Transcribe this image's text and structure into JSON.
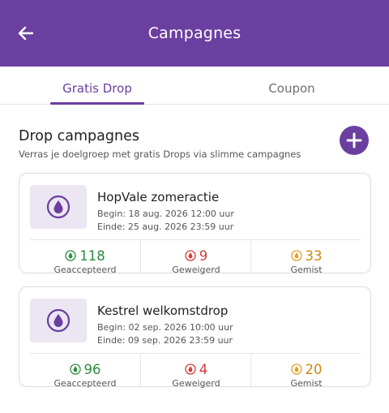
{
  "header": {
    "title": "Campagnes",
    "back_icon": "arrow-left-icon"
  },
  "tabs": [
    {
      "label": "Gratis Drop",
      "active": true
    },
    {
      "label": "Coupon",
      "active": false
    }
  ],
  "section": {
    "title": "Drop campagnes",
    "subtitle": "Verras je doelgroep met gratis Drops via slimme campagnes",
    "add_icon": "plus-icon"
  },
  "colors": {
    "brand": "#6b3fa0",
    "accepted": "#2e8b3e",
    "rejected": "#d23b3b",
    "missed": "#e3a020"
  },
  "campaigns": [
    {
      "name": "HopVale zomeractie",
      "begin": "Begin: 18 aug. 2026 12:00 uur",
      "end": "Einde: 25 aug. 2026 23:59 uur",
      "stats": {
        "accepted": {
          "value": "118",
          "label": "Geaccepteerd"
        },
        "rejected": {
          "value": "9",
          "label": "Geweigerd"
        },
        "missed": {
          "value": "33",
          "label": "Gemist"
        }
      }
    },
    {
      "name": "Kestrel welkomstdrop",
      "begin": "Begin: 02 sep. 2026 10:00 uur",
      "end": "Einde: 09 sep. 2026 23:59 uur",
      "stats": {
        "accepted": {
          "value": "96",
          "label": "Geaccepteerd"
        },
        "rejected": {
          "value": "4",
          "label": "Geweigerd"
        },
        "missed": {
          "value": "20",
          "label": "Gemist"
        }
      }
    }
  ]
}
